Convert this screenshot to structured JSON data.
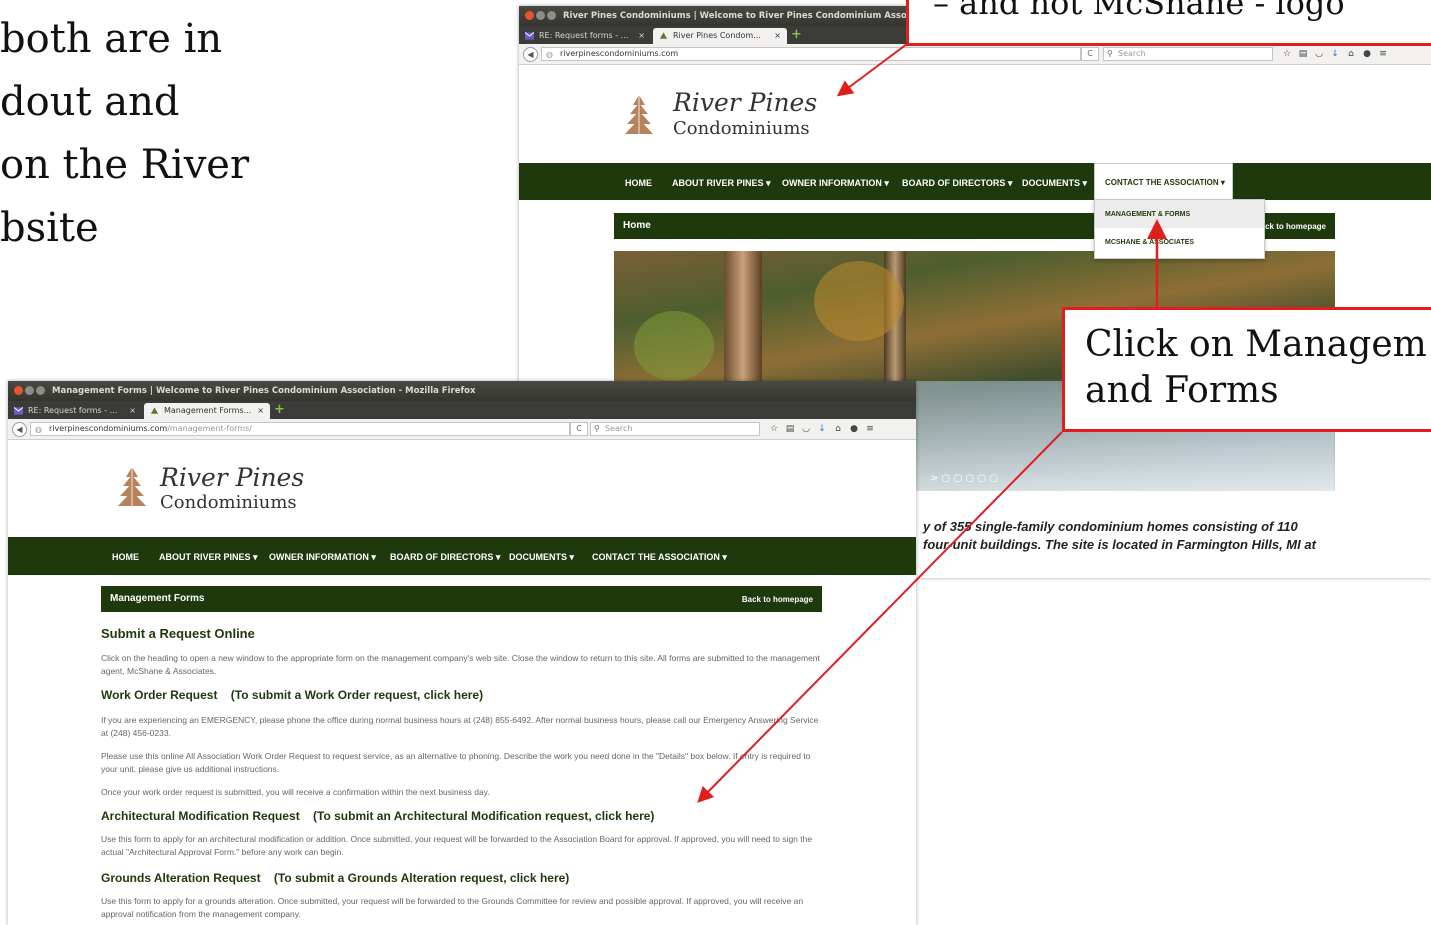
{
  "slide": {
    "lines": [
      "both are in",
      "dout and",
      "on the River",
      "bsite"
    ],
    "callout_top": "– and not McShane - logo",
    "callout_right_lines": [
      "Click on Managem",
      "and Forms"
    ]
  },
  "back_window": {
    "title": "River Pines Condominiums | Welcome to River Pines Condominium Association -",
    "tabs": [
      {
        "label": "RE: Request forms - ...",
        "close": "×"
      },
      {
        "label": "River Pines Condom...",
        "close": "×"
      }
    ],
    "new_tab": "+",
    "url": "riverpinescondominiums.com",
    "reload": "C",
    "search_placeholder": "Search",
    "logo": {
      "line1": "River Pines",
      "line2": "Condominiums"
    },
    "nav": [
      "HOME",
      "ABOUT RIVER PINES ▾",
      "OWNER INFORMATION ▾",
      "BOARD OF DIRECTORS ▾",
      "DOCUMENTS ▾",
      "CONTACT THE ASSOCIATION ▾"
    ],
    "header": {
      "title": "Home",
      "back_link": "Back to homepage"
    },
    "dropdown": [
      "MANAGEMENT & FORMS",
      "MCSHANE & ASSOCIATES"
    ],
    "slider_dots": "> ○ ○ ○ ○ ○",
    "intro_lines": [
      "y of 355 single-family condominium homes consisting of 110",
      "four-unit buildings.  The site is located in Farmington Hills, MI at"
    ]
  },
  "front_window": {
    "title": "Management Forms | Welcome to River Pines Condominium Association - Mozilla Firefox",
    "tabs": [
      {
        "label": "RE: Request forms - ...",
        "close": "×"
      },
      {
        "label": "Management Forms...",
        "close": "×"
      }
    ],
    "new_tab": "+",
    "url_domain": "riverpinescondominiums.com",
    "url_path": "/management-forms/",
    "reload": "C",
    "search_placeholder": "Search",
    "logo": {
      "line1": "River Pines",
      "line2": "Condominiums"
    },
    "nav": [
      "HOME",
      "ABOUT RIVER PINES ▾",
      "OWNER INFORMATION ▾",
      "BOARD OF DIRECTORS ▾",
      "DOCUMENTS ▾",
      "CONTACT THE ASSOCIATION ▾"
    ],
    "header": {
      "title": "Management Forms",
      "back_link": "Back to homepage"
    },
    "submit_heading": "Submit a Request Online",
    "submit_text": "Click on the heading to open a new window to the appropriate form on the management company's web site. Close the window to return to this site. All forms are submitted to the management agent, McShane & Associates.",
    "work_order": {
      "heading": "Work Order Request    (To submit a Work Order request, click here)",
      "p1": "If you are experiencing an EMERGENCY, please phone the office during normal business hours at (248) 855-6492. After normal business hours, please call our Emergency Answering Service at (248) 456-0233.",
      "p2": "Please use this online All Association Work Order Request to request service, as an alternative to phoning. Describe the work you need done in the \"Details\" box below. If entry is required to your unit, please give us additional instructions.",
      "p3": "Once your work order request is submitted, you will receive a confirmation within the next business day."
    },
    "architectural": {
      "heading": "Architectural Modification Request    (To submit an Architectural Modification request, click here)",
      "p1": "Use this form to apply for an architectural modification or addition. Once submitted, your request will be forwarded to the Association Board for approval. If approved, you will need to sign the actual \"Architectural Approval Form.\" before any work can begin."
    },
    "grounds": {
      "heading": "Grounds Alteration Request    (To submit a Grounds Alteration request, click here)",
      "p1": "Use this form to apply for a grounds alteration. Once submitted, your request will be forwarded to the Grounds Committee for review and possible approval. If approved, you will receive an approval notification from the management company."
    }
  },
  "toolbar_icons": [
    "star-icon",
    "clipboard-icon",
    "pocket-icon",
    "download-icon",
    "home-icon",
    "chat-icon",
    "menu-icon"
  ],
  "colors": {
    "nav_green": "#1e3a0c",
    "callout_red": "#e01e1e",
    "titlebar": "#3b3b37"
  }
}
